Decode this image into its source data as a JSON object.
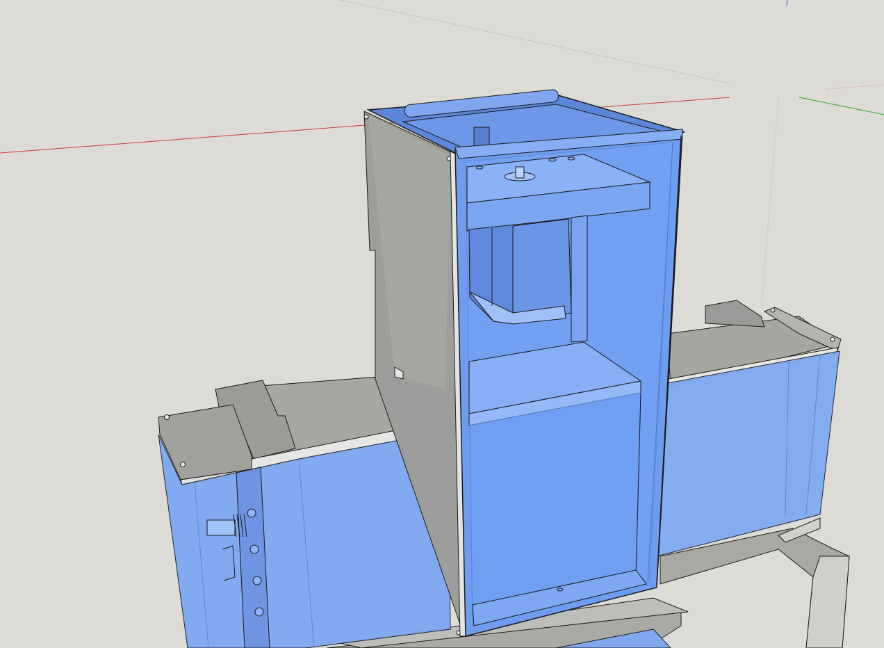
{
  "app": {
    "view": "3d-model-viewport"
  },
  "scene": {
    "background_color": "#dcdbd6",
    "axis_colors": {
      "red": "#d23a3a",
      "green": "#2ea52e",
      "blue": "#3a3ad2"
    },
    "materials": {
      "glass_blue": "#6f9df0",
      "glass_blue_dark": "#5c86d8",
      "glass_blue_light": "#8eb4f6",
      "steel_gray": "#9c9c9a",
      "steel_gray_light": "#b9b9b6",
      "steel_gray_dark": "#7d7d7b",
      "edge": "#1a1a1a"
    },
    "model_parts": [
      "central-tower-enclosure",
      "left-axis-enclosure",
      "right-axis-enclosure",
      "stepper-motor",
      "base-plate",
      "side-panel"
    ]
  }
}
